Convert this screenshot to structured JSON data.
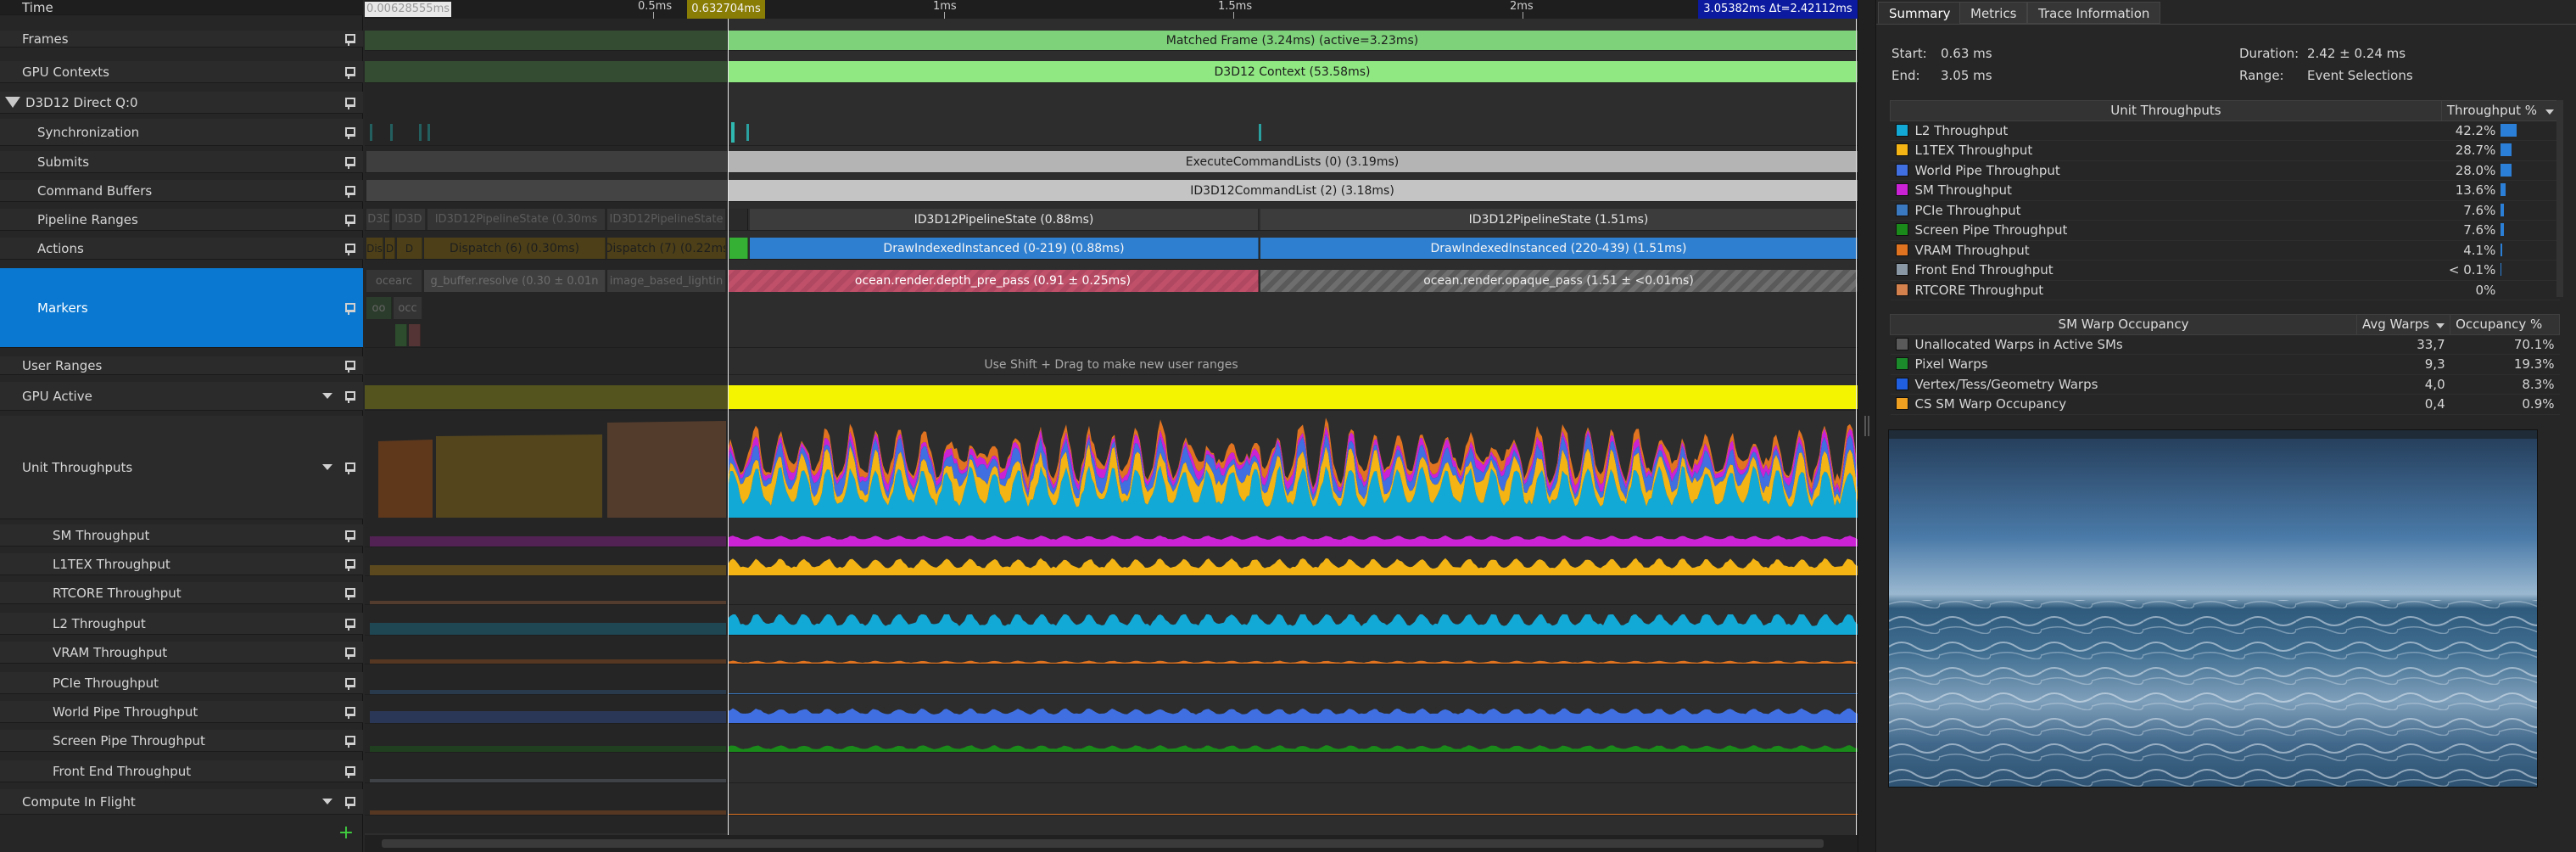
{
  "labels": [
    {
      "text": "Time",
      "pin": false,
      "chev": false,
      "indent": 26,
      "tri": false
    },
    {
      "text": "Frames",
      "pin": true,
      "chev": false,
      "indent": 26,
      "tri": false
    },
    {
      "text": "GPU Contexts",
      "pin": true,
      "chev": false,
      "indent": 26,
      "tri": false
    },
    {
      "text": "D3D12 Direct Q:0",
      "pin": true,
      "chev": false,
      "indent": 0,
      "tri": true
    },
    {
      "text": "Synchronization",
      "pin": true,
      "chev": false,
      "indent": 44,
      "tri": false
    },
    {
      "text": "Submits",
      "pin": true,
      "chev": false,
      "indent": 44,
      "tri": false
    },
    {
      "text": "Command Buffers",
      "pin": true,
      "chev": false,
      "indent": 44,
      "tri": false
    },
    {
      "text": "Pipeline Ranges",
      "pin": true,
      "chev": false,
      "indent": 44,
      "tri": false
    },
    {
      "text": "Actions",
      "pin": true,
      "chev": false,
      "indent": 44,
      "tri": false
    },
    {
      "text": "Markers",
      "pin": true,
      "chev": false,
      "indent": 44,
      "tri": false,
      "selected": true
    },
    {
      "text": "User Ranges",
      "pin": true,
      "chev": false,
      "indent": 26,
      "tri": false
    },
    {
      "text": "GPU Active",
      "pin": true,
      "chev": true,
      "indent": 26,
      "tri": false
    },
    {
      "text": "Unit Throughputs",
      "pin": true,
      "chev": true,
      "indent": 26,
      "tri": false
    },
    {
      "text": "SM Throughput",
      "pin": true,
      "chev": false,
      "indent": 62,
      "tri": false
    },
    {
      "text": "L1TEX Throughput",
      "pin": true,
      "chev": false,
      "indent": 62,
      "tri": false
    },
    {
      "text": "RTCORE Throughput",
      "pin": true,
      "chev": false,
      "indent": 62,
      "tri": false
    },
    {
      "text": "L2 Throughput",
      "pin": true,
      "chev": false,
      "indent": 62,
      "tri": false
    },
    {
      "text": "VRAM Throughput",
      "pin": true,
      "chev": false,
      "indent": 62,
      "tri": false
    },
    {
      "text": "PCIe Throughput",
      "pin": true,
      "chev": false,
      "indent": 62,
      "tri": false
    },
    {
      "text": "World Pipe Throughput",
      "pin": true,
      "chev": false,
      "indent": 62,
      "tri": false
    },
    {
      "text": "Screen Pipe Throughput",
      "pin": true,
      "chev": false,
      "indent": 62,
      "tri": false
    },
    {
      "text": "Front End Throughput",
      "pin": true,
      "chev": false,
      "indent": 62,
      "tri": false
    },
    {
      "text": "Compute In Flight",
      "pin": true,
      "chev": true,
      "indent": 26,
      "tri": false
    }
  ],
  "ruler": {
    "left_readout": "0.00628555ms",
    "cursor_readout": "0.632704ms",
    "right_readout": "3.05382ms Δt=2.42112ms",
    "ticks": [
      "0.5ms",
      "1ms",
      "1.5ms",
      "2ms"
    ]
  },
  "timeline": {
    "frame": "Matched Frame (3.24ms) (active=3.23ms)",
    "context": "D3D12 Context (53.58ms)",
    "submit": "ExecuteCommandLists (0) (3.19ms)",
    "cmdbuf": "ID3D12CommandList (2) (3.18ms)",
    "pipe_pre1": "ID3D",
    "pipe_pre2": "ID3D",
    "pipe_pre3": "ID3D12PipelineState (0.30ms",
    "pipe_pre4": "ID3D12PipelineState",
    "pipe1": "ID3D12PipelineState (0.88ms)",
    "pipe2": "ID3D12PipelineState (1.51ms)",
    "act_pre1": "Dis",
    "act_pre2": "D",
    "act_pre3": "D",
    "act_pre4": "Dispatch (6) (0.30ms)",
    "act_pre5": "Dispatch (7) (0.22ms",
    "act1": "DrawIndexedInstanced (0-219) (0.88ms)",
    "act2": "DrawIndexedInstanced (220-439) (1.51ms)",
    "mark_pre1": "ocearc",
    "mark_pre2": "g_buffer.resolve (0.30 ± 0.01n",
    "mark_pre3": "image_based_lightin",
    "mark_pre4": "oo",
    "mark_pre5": "occ",
    "mark1": "ocean.render.depth_pre_pass (0.91 ± 0.25ms)",
    "mark2": "ocean.render.opaque_pass (1.51 ± <0.01ms)",
    "user_hint": "Use Shift + Drag to make new user ranges"
  },
  "tabs": [
    "Summary",
    "Metrics",
    "Trace Information"
  ],
  "summary": {
    "start_label": "Start:",
    "start_value": "0.63 ms",
    "end_label": "End:",
    "end_value": "3.05 ms",
    "duration_label": "Duration:",
    "duration_value": "2.42 ± 0.24 ms",
    "range_label": "Range:",
    "range_value": "Event Selections"
  },
  "unit_table": {
    "header_name": "Unit Throughputs",
    "header_value": "Throughput %",
    "rows": [
      {
        "name": "L2 Throughput",
        "value": "42.2%",
        "pct": 42.2,
        "color": "#13a9d6"
      },
      {
        "name": "L1TEX Throughput",
        "value": "28.7%",
        "pct": 28.7,
        "color": "#f4b414"
      },
      {
        "name": "World Pipe Throughput",
        "value": "28.0%",
        "pct": 28.0,
        "color": "#3f6fe0"
      },
      {
        "name": "SM Throughput",
        "value": "13.6%",
        "pct": 13.6,
        "color": "#cc22d6"
      },
      {
        "name": "PCIe Throughput",
        "value": "7.6%",
        "pct": 7.6,
        "color": "#3a78c0"
      },
      {
        "name": "Screen Pipe Throughput",
        "value": "7.6%",
        "pct": 7.6,
        "color": "#1a8a1a"
      },
      {
        "name": "VRAM Throughput",
        "value": "4.1%",
        "pct": 4.1,
        "color": "#e07320"
      },
      {
        "name": "Front End Throughput",
        "value": "< 0.1%",
        "pct": 0.1,
        "color": "#8a97a5"
      },
      {
        "name": "RTCORE Throughput",
        "value": "0%",
        "pct": 0,
        "color": "#d5814d"
      }
    ]
  },
  "warp_table": {
    "header_name": "SM Warp Occupancy",
    "header_avg": "Avg Warps",
    "header_occ": "Occupancy %",
    "rows": [
      {
        "name": "Unallocated Warps in Active SMs",
        "avg": "33,7",
        "occ": "70.1%",
        "color": "#5a5a5a"
      },
      {
        "name": "Pixel Warps",
        "avg": "9,3",
        "occ": "19.3%",
        "color": "#1b8a2a"
      },
      {
        "name": "Vertex/Tess/Geometry Warps",
        "avg": "4,0",
        "occ": "8.3%",
        "color": "#1f5fe0"
      },
      {
        "name": "CS SM Warp Occupancy",
        "avg": "0,4",
        "occ": "0.9%",
        "color": "#f0a020"
      }
    ]
  },
  "icons": {
    "pin": "pin-icon",
    "chevron": "chevron-down-icon",
    "add": "plus-icon",
    "expand": "triangle-down-icon"
  }
}
